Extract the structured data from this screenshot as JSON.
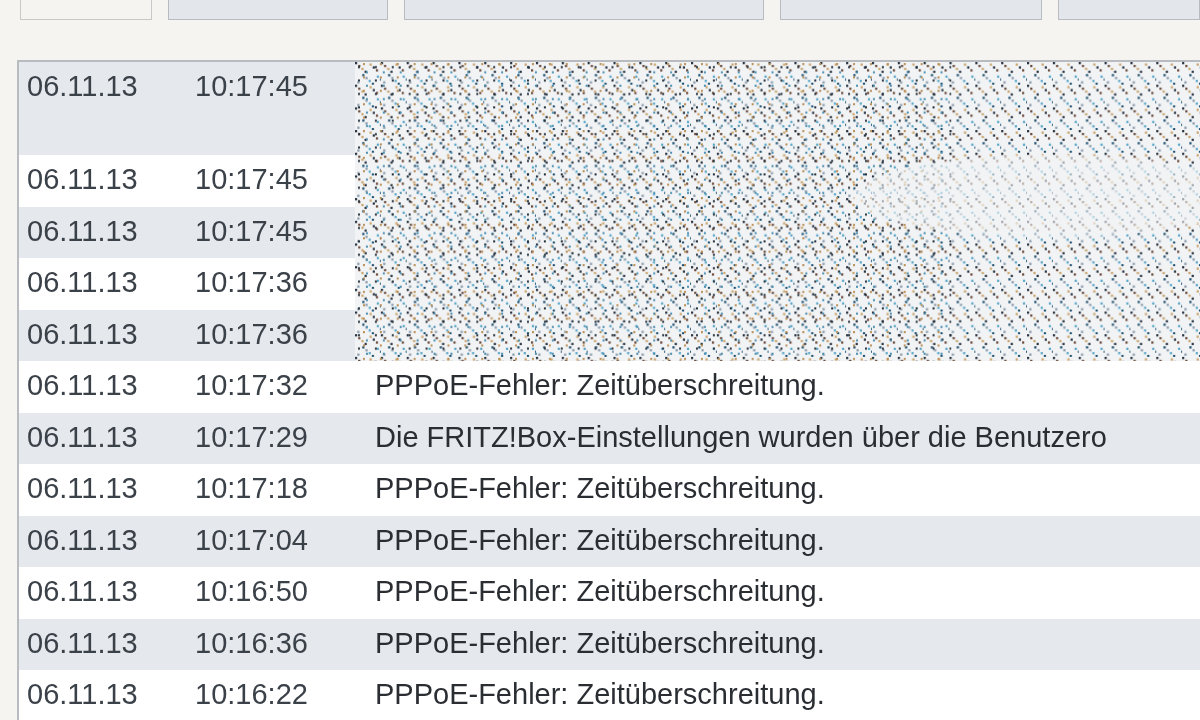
{
  "tabs": [
    {
      "selected": true
    },
    {
      "selected": false
    },
    {
      "selected": false
    },
    {
      "selected": false
    },
    {
      "selected": false
    }
  ],
  "log": {
    "rows": [
      {
        "date": "06.11.13",
        "time": "10:17:45",
        "tall": true
      },
      {
        "date": "06.11.13",
        "time": "10:17:45",
        "tall": false
      },
      {
        "date": "06.11.13",
        "time": "10:17:45",
        "tall": false
      },
      {
        "date": "06.11.13",
        "time": "10:17:36",
        "tall": false
      },
      {
        "date": "06.11.13",
        "time": "10:17:36",
        "tall": false
      },
      {
        "date": "06.11.13",
        "time": "10:17:32",
        "tall": false,
        "message": "PPPoE-Fehler: Zeitüberschreitung."
      },
      {
        "date": "06.11.13",
        "time": "10:17:29",
        "tall": false,
        "message": "Die FRITZ!Box-Einstellungen wurden über die Benutzero"
      },
      {
        "date": "06.11.13",
        "time": "10:17:18",
        "tall": false,
        "message": "PPPoE-Fehler: Zeitüberschreitung."
      },
      {
        "date": "06.11.13",
        "time": "10:17:04",
        "tall": false,
        "message": "PPPoE-Fehler: Zeitüberschreitung."
      },
      {
        "date": "06.11.13",
        "time": "10:16:50",
        "tall": false,
        "message": "PPPoE-Fehler: Zeitüberschreitung."
      },
      {
        "date": "06.11.13",
        "time": "10:16:36",
        "tall": false,
        "message": "PPPoE-Fehler: Zeitüberschreitung."
      },
      {
        "date": "06.11.13",
        "time": "10:16:22",
        "tall": false,
        "message": "PPPoE-Fehler: Zeitüberschreitung."
      }
    ]
  }
}
